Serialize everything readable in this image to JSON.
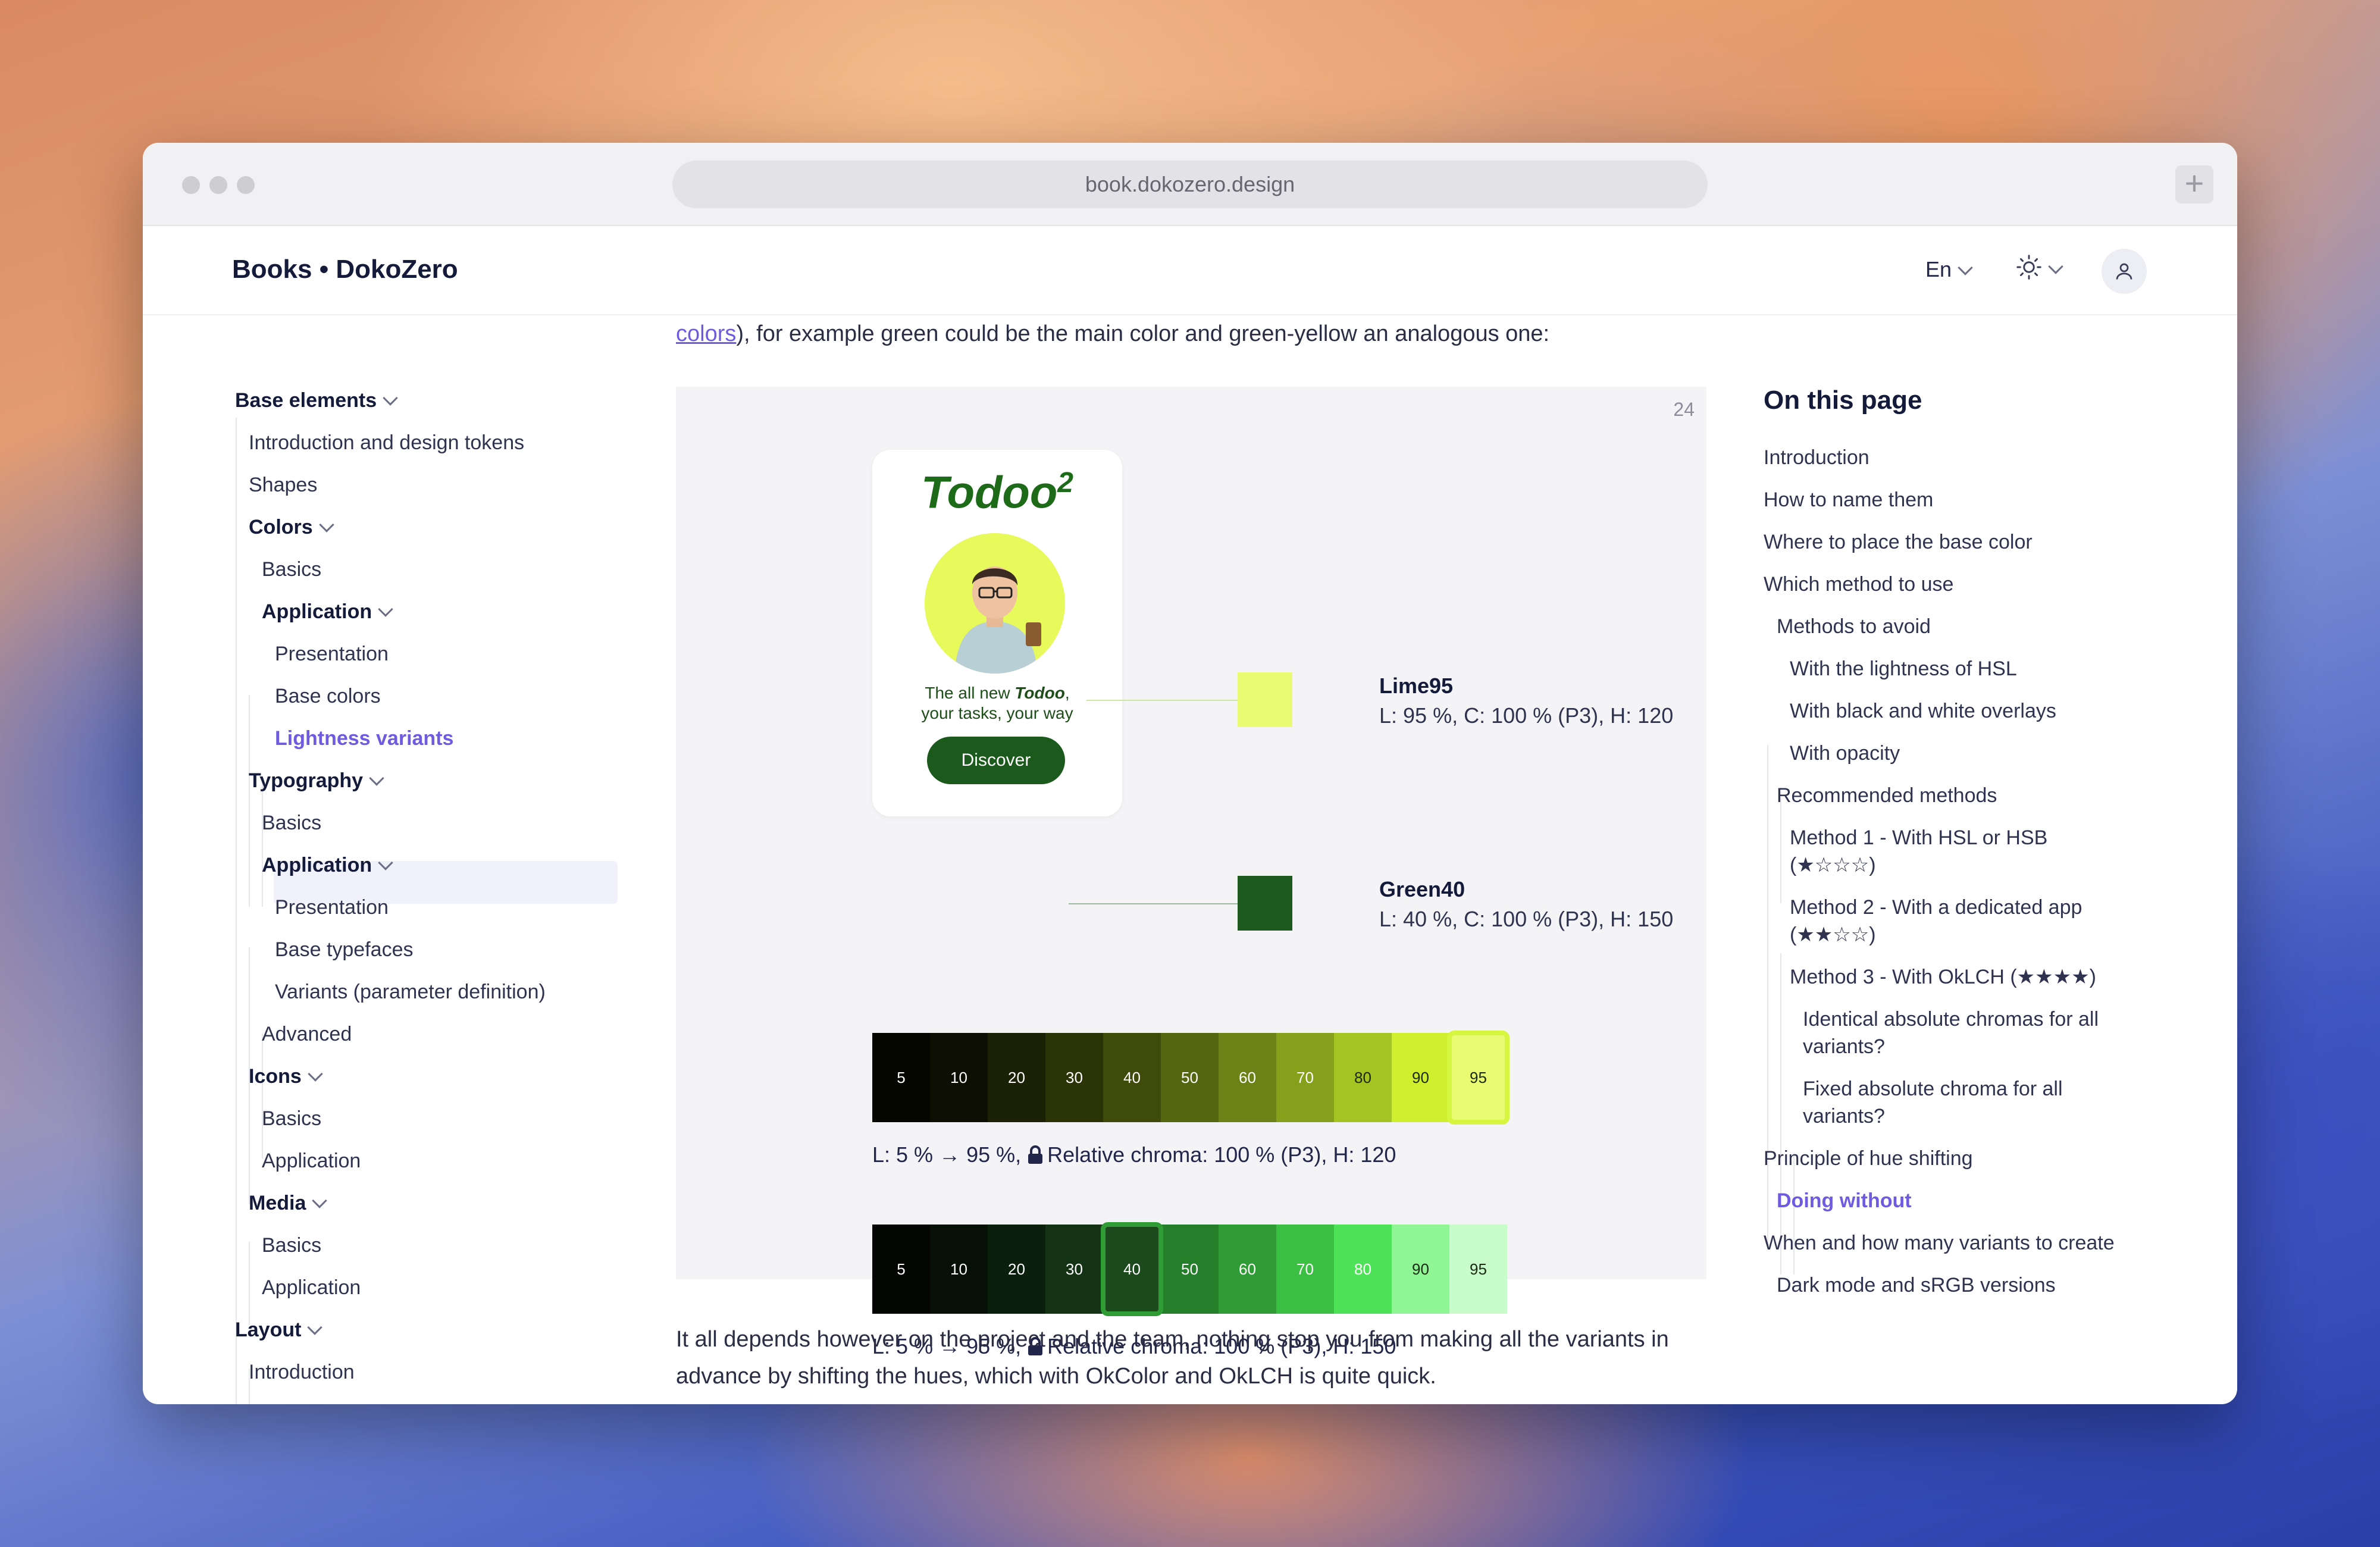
{
  "browser": {
    "url": "book.dokozero.design",
    "new_tab": "+"
  },
  "header": {
    "brand": "Books • DokoZero",
    "language": "En"
  },
  "sidebar": {
    "base_elements": "Base elements",
    "intro_tokens": "Introduction and design tokens",
    "shapes": "Shapes",
    "colors": "Colors",
    "colors_basics": "Basics",
    "colors_application": "Application",
    "colors_presentation": "Presentation",
    "colors_base": "Base colors",
    "colors_lightness": "Lightness variants",
    "typography": "Typography",
    "typo_basics": "Basics",
    "typo_application": "Application",
    "typo_presentation": "Presentation",
    "typo_base": "Base typefaces",
    "typo_variants": "Variants (parameter definition)",
    "typo_advanced": "Advanced",
    "icons": "Icons",
    "icons_basics": "Basics",
    "icons_application": "Application",
    "media": "Media",
    "media_basics": "Basics",
    "media_application": "Application",
    "layout": "Layout",
    "layout_intro": "Introduction"
  },
  "content": {
    "intro_link": "colors",
    "intro_text": "), for example green could be the main color and green-yellow an analogous one:",
    "figure_number": "24",
    "app_title": "Todoo",
    "app_sup": "2",
    "tagline_1": "The all new ",
    "tagline_brand": "Todoo",
    "tagline_2": ",",
    "tagline_3": "your tasks, your way",
    "discover": "Discover",
    "lime_name": "Lime95",
    "lime_spec": "L: 95 %, C: 100 % (P3), H: 120",
    "green_name": "Green40",
    "green_spec": "L: 40 %, C: 100 % (P3), H: 150",
    "scale1_caption_a": "L: 5 % → 95 %, ",
    "scale1_caption_b": "Relative chroma: 100 % (P3), H: 120",
    "scale2_caption_a": "L: 5 % → 95 %, ",
    "scale2_caption_b": "Relative chroma: 100 % (P3), H: 150",
    "outro": "It all depends however on the project and the team, nothing stop you from making all the variants in advance by shifting the hues, which with OkColor and OkLCH is quite quick."
  },
  "scale_lime": {
    "steps": [
      "5",
      "10",
      "20",
      "30",
      "40",
      "50",
      "60",
      "70",
      "80",
      "90",
      "95"
    ],
    "colors": [
      "#050600",
      "#0d0f02",
      "#1b2104",
      "#2b3407",
      "#3e4b0a",
      "#556610",
      "#6c8216",
      "#86a01c",
      "#a4c424",
      "#cfee2e",
      "#e9fb73"
    ],
    "highlight": "95"
  },
  "scale_green": {
    "steps": [
      "5",
      "10",
      "20",
      "30",
      "40",
      "50",
      "60",
      "70",
      "80",
      "90",
      "95"
    ],
    "colors": [
      "#020502",
      "#061006",
      "#0b200c",
      "#133314",
      "#1c4a1d",
      "#257f2a",
      "#2f9c35",
      "#3cc044",
      "#4de257",
      "#8ff595",
      "#c8fccb"
    ],
    "highlight": "40"
  },
  "toc": {
    "title": "On this page",
    "items": [
      "Introduction",
      "How to name them",
      "Where to place the base color",
      "Which method to use",
      "Methods to avoid",
      "With the lightness of HSL",
      "With black and white overlays",
      "With opacity",
      "Recommended methods",
      "Method 1 - With HSL or HSB (★☆☆☆)",
      "Method 2 - With a dedicated app (★★☆☆)",
      "Method 3 - With OkLCH (★★★★)",
      "Identical absolute chromas for all variants?",
      "Fixed absolute chroma for all variants?",
      "Principle of hue shifting",
      "Doing without",
      "When and how many variants to create",
      "Dark mode and sRGB versions"
    ],
    "active": "Doing without"
  },
  "colors": {
    "accent": "#6f5be0",
    "lime": "#e9fb73",
    "green": "#1b5a1c"
  }
}
